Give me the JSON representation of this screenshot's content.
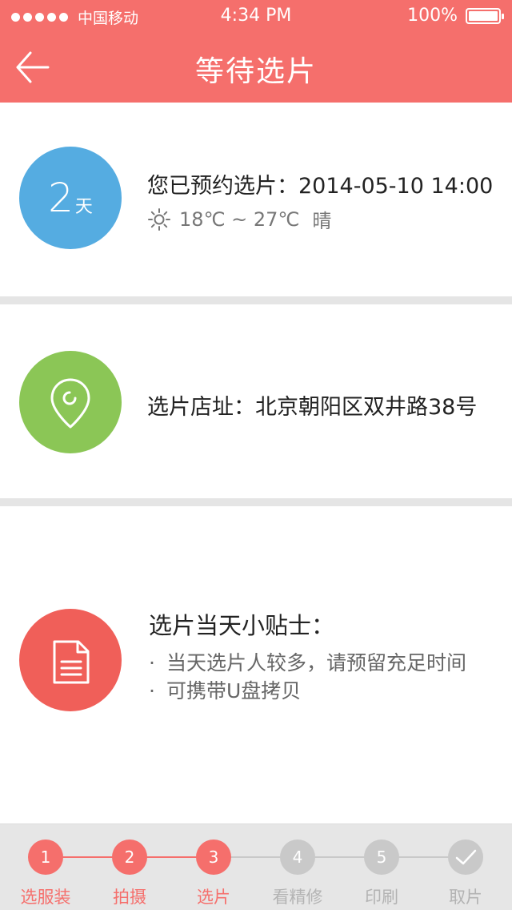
{
  "status_bar": {
    "carrier": "中国移动",
    "time": "4:34 PM",
    "battery": "100%"
  },
  "nav": {
    "title": "等待选片",
    "back_icon": "arrow-left-icon"
  },
  "appointment": {
    "days_value": "2",
    "days_unit": "天",
    "label": "您已预约选片：",
    "datetime": "2014-05-10 14:00",
    "weather_icon": "sun-icon",
    "temperature": "18℃ ~ 27℃",
    "condition": "晴"
  },
  "address": {
    "icon": "map-pin-icon",
    "label": "选片店址：",
    "value": "北京朝阳区双井路38号"
  },
  "tips": {
    "icon": "document-icon",
    "title": "选片当天小贴士：",
    "items": [
      "当天选片人较多，请预留充足时间",
      "可携带U盘拷贝"
    ]
  },
  "steps": [
    {
      "number": "1",
      "label": "选服装",
      "state": "done"
    },
    {
      "number": "2",
      "label": "拍摄",
      "state": "done"
    },
    {
      "number": "3",
      "label": "选片",
      "state": "done"
    },
    {
      "number": "4",
      "label": "看精修",
      "state": "todo"
    },
    {
      "number": "5",
      "label": "印刷",
      "state": "todo"
    },
    {
      "number": "",
      "label": "取片",
      "state": "todo",
      "icon": "checkmark-icon"
    }
  ],
  "colors": {
    "accent": "#f56f6c",
    "blue": "#55ace1",
    "green": "#8bc656",
    "red": "#f05f59",
    "inactive": "#c9c9c9"
  }
}
